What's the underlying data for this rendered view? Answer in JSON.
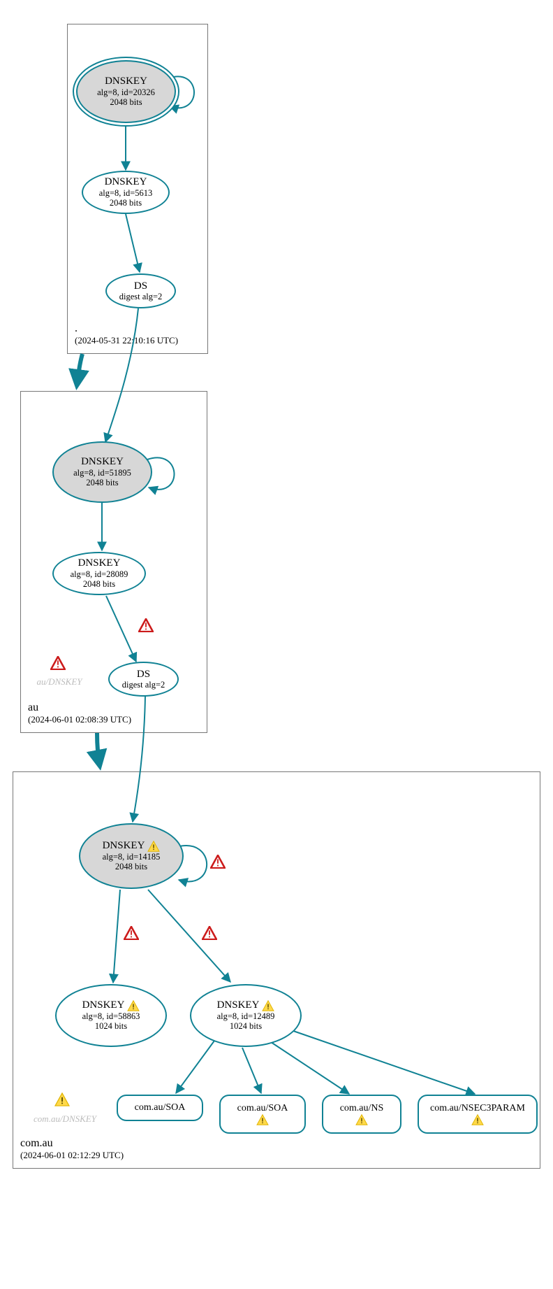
{
  "zones": {
    "root": {
      "name": ".",
      "timestamp": "(2024-05-31 22:10:16 UTC)"
    },
    "au": {
      "name": "au",
      "timestamp": "(2024-06-01 02:08:39 UTC)"
    },
    "comau": {
      "name": "com.au",
      "timestamp": "(2024-06-01 02:12:29 UTC)"
    }
  },
  "nodes": {
    "root_ksk": {
      "title": "DNSKEY",
      "line2": "alg=8, id=20326",
      "line3": "2048 bits"
    },
    "root_zsk": {
      "title": "DNSKEY",
      "line2": "alg=8, id=5613",
      "line3": "2048 bits"
    },
    "root_ds": {
      "title": "DS",
      "line2": "digest alg=2"
    },
    "au_ksk": {
      "title": "DNSKEY",
      "line2": "alg=8, id=51895",
      "line3": "2048 bits"
    },
    "au_zsk": {
      "title": "DNSKEY",
      "line2": "alg=8, id=28089",
      "line3": "2048 bits"
    },
    "au_ds": {
      "title": "DS",
      "line2": "digest alg=2"
    },
    "au_ghost": {
      "label": "au/DNSKEY"
    },
    "comau_ksk": {
      "title": "DNSKEY",
      "line2": "alg=8, id=14185",
      "line3": "2048 bits"
    },
    "comau_zsk1": {
      "title": "DNSKEY",
      "line2": "alg=8, id=58863",
      "line3": "1024 bits"
    },
    "comau_zsk2": {
      "title": "DNSKEY",
      "line2": "alg=8, id=12489",
      "line3": "1024 bits"
    },
    "comau_ghost": {
      "label": "com.au/DNSKEY"
    },
    "rr_soa1": {
      "label": "com.au/SOA"
    },
    "rr_soa2": {
      "label": "com.au/SOA"
    },
    "rr_ns": {
      "label": "com.au/NS"
    },
    "rr_nsec3": {
      "label": "com.au/NSEC3PARAM"
    }
  }
}
